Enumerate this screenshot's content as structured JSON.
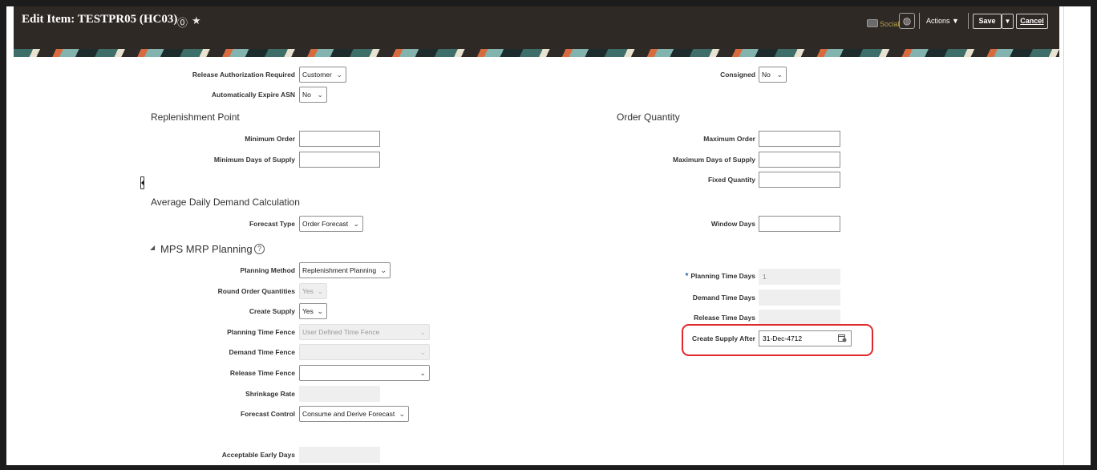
{
  "header": {
    "title": "Edit Item: TESTPR05 (HC03)",
    "social_label": "Social",
    "actions_label": "Actions ▼",
    "save_label": "Save",
    "save_menu_glyph": "▼",
    "cancel_label": "Cancel"
  },
  "fields": {
    "release_authorization_required": {
      "label": "Release Authorization Required",
      "value": "Customer"
    },
    "automatically_expire_asn": {
      "label": "Automatically Expire ASN",
      "value": "No"
    },
    "consigned": {
      "label": "Consigned",
      "value": "No"
    }
  },
  "replenishment_point": {
    "heading": "Replenishment Point",
    "minimum_order": {
      "label": "Minimum Order",
      "value": ""
    },
    "minimum_days_of_supply": {
      "label": "Minimum Days of Supply",
      "value": ""
    }
  },
  "order_quantity": {
    "heading": "Order Quantity",
    "maximum_order": {
      "label": "Maximum Order",
      "value": ""
    },
    "maximum_days_of_supply": {
      "label": "Maximum Days of Supply",
      "value": ""
    },
    "fixed_quantity": {
      "label": "Fixed Quantity",
      "value": ""
    }
  },
  "average_daily_demand": {
    "heading": "Average Daily Demand Calculation",
    "forecast_type": {
      "label": "Forecast Type",
      "value": "Order Forecast"
    },
    "window_days": {
      "label": "Window Days",
      "value": ""
    }
  },
  "mps_mrp": {
    "heading": "MPS MRP Planning",
    "toggle_glyph": "◢",
    "planning_method": {
      "label": "Planning Method",
      "value": "Replenishment Planning"
    },
    "round_order_quantities": {
      "label": "Round Order Quantities",
      "value": "Yes"
    },
    "create_supply": {
      "label": "Create Supply",
      "value": "Yes"
    },
    "planning_time_fence": {
      "label": "Planning Time Fence",
      "value": "User Defined Time Fence"
    },
    "demand_time_fence": {
      "label": "Demand Time Fence",
      "value": ""
    },
    "release_time_fence": {
      "label": "Release Time Fence",
      "value": ""
    },
    "shrinkage_rate": {
      "label": "Shrinkage Rate",
      "value": ""
    },
    "forecast_control": {
      "label": "Forecast Control",
      "value": "Consume and Derive Forecast"
    },
    "acceptable_early_days": {
      "label": "Acceptable Early Days",
      "value": ""
    },
    "planning_time_days": {
      "label": "Planning Time Days",
      "value": "1",
      "required_mark": "*"
    },
    "demand_time_days": {
      "label": "Demand Time Days",
      "value": ""
    },
    "release_time_days": {
      "label": "Release Time Days",
      "value": ""
    },
    "create_supply_after": {
      "label": "Create Supply After",
      "value": "31-Dec-4712"
    }
  },
  "colors": {
    "header_bg": "#2f2926",
    "highlight": "#e0272e",
    "required": "#1d5fa9"
  }
}
